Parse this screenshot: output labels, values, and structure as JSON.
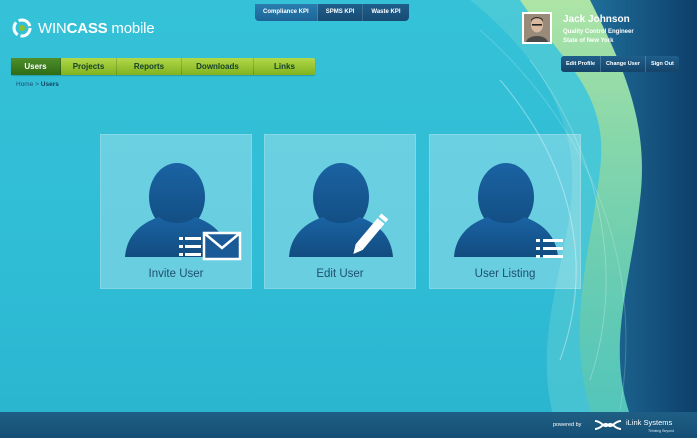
{
  "app": {
    "logo_prefix": "WIN",
    "logo_bold": "CASS",
    "logo_suffix": " mobile"
  },
  "kpi_tabs": [
    "Compliance KPI",
    "SPMS KPI",
    "Waste KPI"
  ],
  "nav": {
    "items": [
      "Users",
      "Projects",
      "Reports",
      "Downloads",
      "Links"
    ],
    "active": "Users"
  },
  "breadcrumb": {
    "home": "Home",
    "separator": " > ",
    "current": "Users"
  },
  "profile": {
    "name": "Jack Johnson",
    "role": "Quality Control Engineer",
    "state": "State of New York",
    "actions": [
      "Edit Profile",
      "Change User",
      "Sign Out"
    ]
  },
  "tiles": [
    {
      "label": "Invite User",
      "icon": "invite-user-icon"
    },
    {
      "label": "Edit User",
      "icon": "edit-user-icon"
    },
    {
      "label": "User Listing",
      "icon": "user-listing-icon"
    }
  ],
  "footer": {
    "powered_by": "powered by",
    "company": "iLink Systems",
    "tagline": "Thinking Beyond"
  },
  "colors": {
    "background": "#35c2d8",
    "nav_green": "#8fc02a",
    "nav_active": "#3d7d20",
    "dark_blue": "#1a5580",
    "icon_blue": "#1a5a96"
  }
}
